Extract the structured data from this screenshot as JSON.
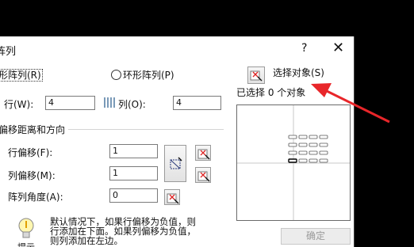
{
  "dialog": {
    "title": "阵列",
    "help": "?",
    "close": "✕"
  },
  "array_type": {
    "rect_label": "矩形阵列(R)",
    "rect_label_visible": "形阵列(R)",
    "polar_label": "环形阵列(P)"
  },
  "rows": {
    "label": "行(W):",
    "value": "4"
  },
  "columns": {
    "label": "列(O):",
    "value": "4"
  },
  "offset_section": {
    "title": "偏移距离和方向",
    "row_offset_label": "行偏移(F):",
    "row_offset_value": "1",
    "col_offset_label": "列偏移(M):",
    "col_offset_value": "1",
    "angle_label": "阵列角度(A):",
    "angle_value": "0"
  },
  "select_objects": {
    "label": "选择对象(S)",
    "status": "已选择 0 个对象"
  },
  "tip": {
    "heading": "提示",
    "line1": "默认情况下，如果行偏移为负值，则",
    "line2": "行添加在下面。如果列偏移为负值，",
    "line3": "则列添加在左边。"
  },
  "buttons": {
    "ok": "确定"
  },
  "colors": {
    "annotation_arrow": "#e8262a"
  }
}
